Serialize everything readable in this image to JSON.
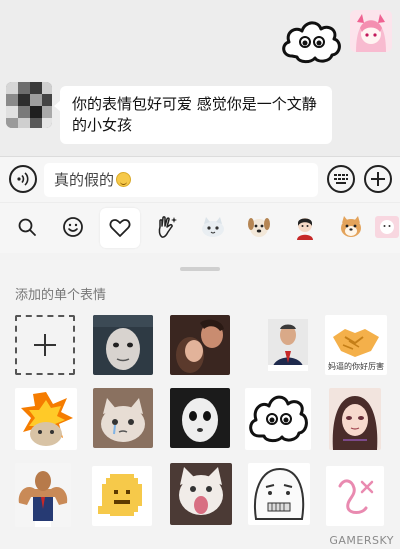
{
  "chat": {
    "received_message": "你的表情包好可爱 感觉你是一个文静的小女孩",
    "sent_sticker_icon": "cloud-face-sticker",
    "self_avatar_icon": "anime-girl-avatar",
    "peer_avatar_icon": "pixelated-avatar"
  },
  "input_bar": {
    "text_value": "真的假的",
    "trailing_emoji_icon": "smile-emoji",
    "voice_icon": "voice-icon",
    "keyboard_icon": "keyboard-icon",
    "plus_icon": "plus-icon"
  },
  "tabs": [
    {
      "icon": "search-icon"
    },
    {
      "icon": "emoji-icon"
    },
    {
      "icon": "heart-icon",
      "active": true
    },
    {
      "icon": "hand-sparkle-icon"
    },
    {
      "icon": "white-cat-sticker-tab"
    },
    {
      "icon": "dog-sticker-tab"
    },
    {
      "icon": "panda-person-sticker-tab"
    },
    {
      "icon": "shiba-sticker-tab"
    },
    {
      "icon": "cat-pink-sticker-tab"
    }
  ],
  "panel": {
    "section_title": "添加的单个表情",
    "add_icon": "plus-icon",
    "stickers": [
      {
        "icon": "blurred-face-sticker"
      },
      {
        "icon": "couple-photo-sticker"
      },
      {
        "icon": "man-suit-sticker"
      },
      {
        "icon": "handshake-sticker",
        "caption": "妈逼的你好厉害"
      },
      {
        "icon": "explosion-cat-sticker"
      },
      {
        "icon": "cat-crying-sticker"
      },
      {
        "icon": "white-mask-sticker"
      },
      {
        "icon": "cloud-face-sticker"
      },
      {
        "icon": "anime-girl-sticker"
      },
      {
        "icon": "muscle-man-sticker"
      },
      {
        "icon": "pixel-smile-sticker"
      },
      {
        "icon": "screaming-cat-sticker"
      },
      {
        "icon": "meme-face-sticker"
      },
      {
        "icon": "pink-doodle-sticker"
      }
    ]
  },
  "watermark": "GAMERSKY"
}
